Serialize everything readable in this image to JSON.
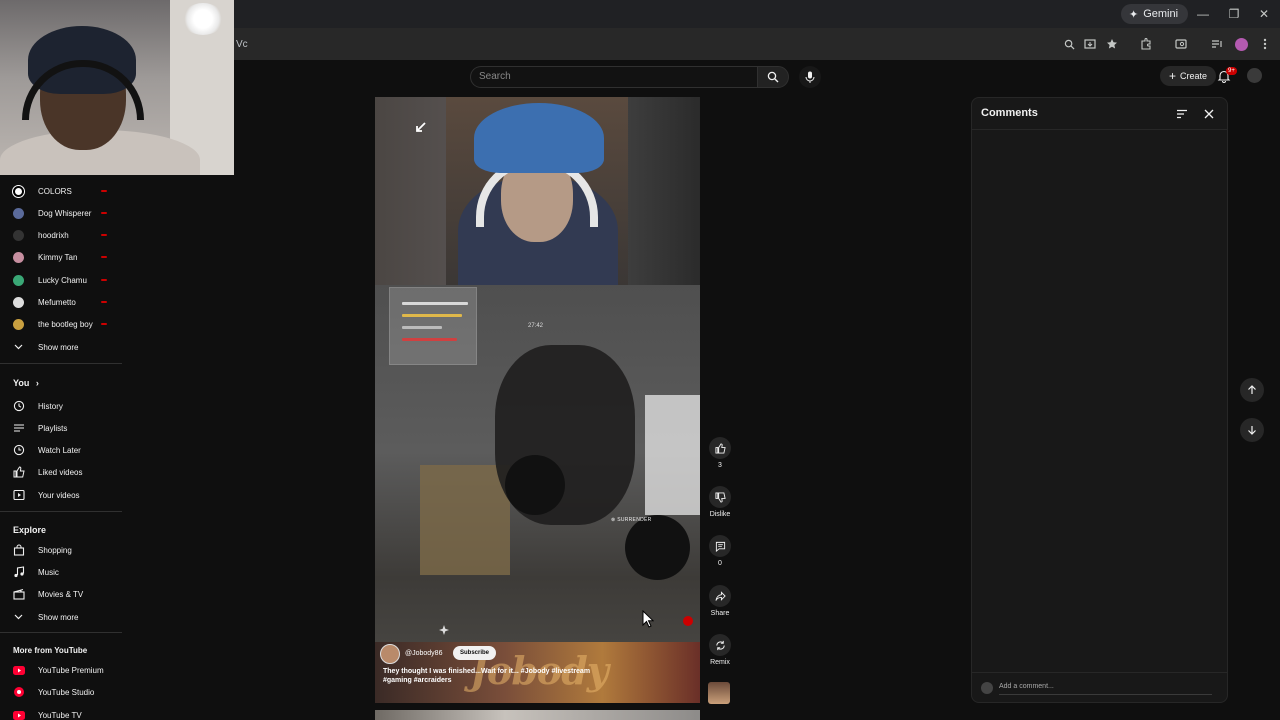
{
  "browser": {
    "gemini_label": "Gemini",
    "url_fragment": "Vc"
  },
  "masthead": {
    "search_placeholder": "Search",
    "create_label": "Create",
    "notifications_badge": "9+"
  },
  "sidebar": {
    "subscriptions": [
      {
        "label": "COLORS",
        "color": "#ffffff"
      },
      {
        "label": "Dog Whisperer",
        "color": "#5a6a9a"
      },
      {
        "label": "hoodrixh",
        "color": "#333333"
      },
      {
        "label": "Kimmy Tan",
        "color": "#c78fa0"
      },
      {
        "label": "Lucky Chamu",
        "color": "#3aa876"
      },
      {
        "label": "Mefumetto",
        "color": "#dddddd"
      },
      {
        "label": "the bootleg boy",
        "color": "#c9a040"
      }
    ],
    "subs_show_more": "Show more",
    "you_heading": "You",
    "you_items": [
      {
        "label": "History",
        "icon": "history-icon"
      },
      {
        "label": "Playlists",
        "icon": "playlists-icon"
      },
      {
        "label": "Watch Later",
        "icon": "clock-icon"
      },
      {
        "label": "Liked videos",
        "icon": "thumbs-up-icon"
      },
      {
        "label": "Your videos",
        "icon": "play-square-icon"
      }
    ],
    "explore_heading": "Explore",
    "explore_items": [
      {
        "label": "Shopping",
        "icon": "bag-icon"
      },
      {
        "label": "Music",
        "icon": "music-icon"
      },
      {
        "label": "Movies & TV",
        "icon": "clapper-icon"
      }
    ],
    "explore_show_more": "Show more",
    "more_heading": "More from YouTube",
    "more_items": [
      {
        "label": "YouTube Premium"
      },
      {
        "label": "YouTube Studio"
      },
      {
        "label": "YouTube TV"
      }
    ]
  },
  "video": {
    "channel": "@Jobody86",
    "subscribe_label": "Subscribe",
    "title": "They thought I was finished...Wait for it... #Jobody #livestream #gaming #arcraiders",
    "banner_text": "Jobody",
    "game_timer": "27:42",
    "surrender_label": "SURRENDER"
  },
  "actions": {
    "like_count": "3",
    "dislike_label": "Dislike",
    "comment_count": "0",
    "share_label": "Share",
    "remix_label": "Remix"
  },
  "comments": {
    "title": "Comments",
    "add_placeholder": "Add a comment..."
  },
  "colors": {
    "background": "#0f0f0f",
    "accent_red": "#cc0000"
  }
}
